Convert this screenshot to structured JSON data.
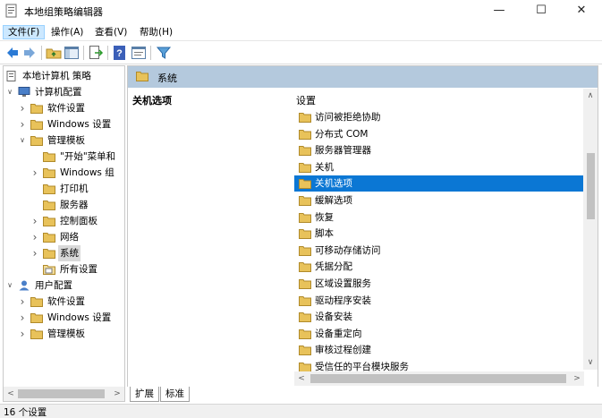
{
  "window": {
    "title": "本地组策略编辑器",
    "minimize_glyph": "—",
    "maximize_glyph": "☐",
    "close_glyph": "✕"
  },
  "menu": [
    "文件(F)",
    "操作(A)",
    "查看(V)",
    "帮助(H)"
  ],
  "toolbar": {
    "icons": [
      "back-icon",
      "forward-icon",
      "up-folder-icon",
      "show-hide-tree-icon",
      "export-list-icon",
      "help-icon",
      "properties-icon",
      "filter-icon"
    ]
  },
  "tree": {
    "nodes": [
      {
        "label": "本地计算机 策略",
        "icon": "policy-icon",
        "arrow": ""
      },
      {
        "label": "计算机配置",
        "icon": "computer-icon",
        "arrow": "v"
      },
      {
        "label": "软件设置",
        "icon": "folder-icon",
        "arrow": ">"
      },
      {
        "label": "Windows 设置",
        "icon": "folder-icon",
        "arrow": ">"
      },
      {
        "label": "管理模板",
        "icon": "folder-icon",
        "arrow": "v"
      },
      {
        "label": "\"开始\"菜单和",
        "icon": "folder-icon",
        "arrow": ""
      },
      {
        "label": "Windows 组",
        "icon": "folder-icon",
        "arrow": ">"
      },
      {
        "label": "打印机",
        "icon": "folder-icon",
        "arrow": ""
      },
      {
        "label": "服务器",
        "icon": "folder-icon",
        "arrow": ""
      },
      {
        "label": "控制面板",
        "icon": "folder-icon",
        "arrow": ">"
      },
      {
        "label": "网络",
        "icon": "folder-icon",
        "arrow": ">"
      },
      {
        "label": "系统",
        "icon": "folder-icon",
        "arrow": ">"
      },
      {
        "label": "所有设置",
        "icon": "all-settings-icon",
        "arrow": ""
      },
      {
        "label": "用户配置",
        "icon": "user-icon",
        "arrow": "v"
      },
      {
        "label": "软件设置",
        "icon": "folder-icon",
        "arrow": ">"
      },
      {
        "label": "Windows 设置",
        "icon": "folder-icon",
        "arrow": ">"
      },
      {
        "label": "管理模板",
        "icon": "folder-icon",
        "arrow": ">"
      }
    ],
    "selected": "系统"
  },
  "right": {
    "header": "系统",
    "description_title": "关机选项",
    "column_header": "设置",
    "items": [
      "访问被拒绝协助",
      "分布式 COM",
      "服务器管理器",
      "关机",
      "关机选项",
      "缓解选项",
      "恢复",
      "脚本",
      "可移动存储访问",
      "凭据分配",
      "区域设置服务",
      "驱动程序安装",
      "设备安装",
      "设备重定向",
      "审核过程创建",
      "受信任的平台模块服务"
    ],
    "selected": "关机选项"
  },
  "tabs": [
    "扩展",
    "标准"
  ],
  "active_tab": "扩展",
  "status": "16 个设置",
  "colors": {
    "folder": "#e8c25a",
    "selection": "#0b77d4",
    "header": "#b4c9dd"
  }
}
